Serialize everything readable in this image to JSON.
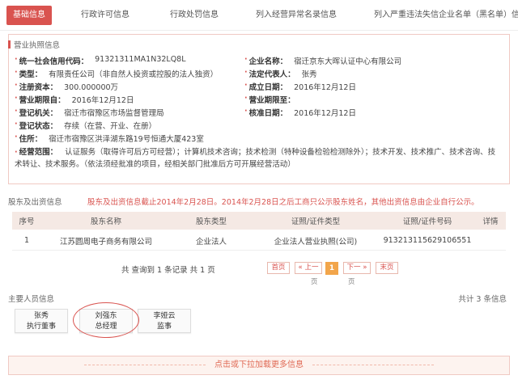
{
  "tabs": [
    {
      "label": "基础信息",
      "active": true
    },
    {
      "label": "行政许可信息",
      "active": false
    },
    {
      "label": "行政处罚信息",
      "active": false
    },
    {
      "label": "列入经营异常名录信息",
      "active": false
    },
    {
      "label": "列入严重违法失信企业名单（黑名单）信息",
      "active": false
    }
  ],
  "license": {
    "section_title": "营业执照信息",
    "credit_code_label": "统一社会信用代码：",
    "credit_code": "91321311MA1N32LQ8L",
    "company_name_label": "企业名称：",
    "company_name": "宿迁京东大晖认证中心有限公司",
    "type_label": "类型：",
    "type": "有限责任公司（非自然人投资或控股的法人独资）",
    "legal_rep_label": "法定代表人：",
    "legal_rep": "张秀",
    "capital_label": "注册资本：",
    "capital": "300.000000万",
    "established_label": "成立日期：",
    "established": "2016年12月12日",
    "term_from_label": "营业期限自：",
    "term_from": "2016年12月12日",
    "term_to_label": "营业期限至：",
    "term_to": "",
    "authority_label": "登记机关：",
    "authority": "宿迁市宿豫区市场监督管理局",
    "approved_label": "核准日期：",
    "approved": "2016年12月12日",
    "status_label": "登记状态：",
    "status": "存续（在营、开业、在册）",
    "address_label": "住所：",
    "address": "宿迁市宿豫区洪泽湖东路19号恒通大厦423室",
    "scope_label": "经营范围：",
    "scope": "认证服务（取得许可后方可经营）；计算机技术咨询；技术检测（特种设备检验检测除外）；技术开发、技术推广、技术咨询、技术转让、技术服务。（依法须经批准的项目，经相关部门批准后方可开展经营活动）"
  },
  "shareholders": {
    "section_title": "股东及出资信息",
    "notice": "股东及出资信息截止2014年2月28日。2014年2月28日之后工商只公示股东姓名，其他出资信息由企业自行公示。",
    "columns": [
      "序号",
      "股东名称",
      "股东类型",
      "证照/证件类型",
      "证照/证件号码",
      "详情"
    ],
    "rows": [
      [
        "1",
        "江苏圆周电子商务有限公司",
        "企业法人",
        "企业法人营业执照(公司)",
        "913213115629106551",
        ""
      ]
    ],
    "pager": {
      "info": "共 查询到 1 条记录 共 1 页",
      "first": "首页",
      "prev": "« 上一",
      "prev_sub": "页",
      "current": "1",
      "next": "下一 »",
      "next_sub": "页",
      "last": "末页"
    }
  },
  "people": {
    "section_title": "主要人员信息",
    "count_text": "共计 3 条信息",
    "items": [
      {
        "name": "张秀",
        "role": "执行董事"
      },
      {
        "name": "刘强东",
        "role": "总经理"
      },
      {
        "name": "李娅云",
        "role": "监事"
      }
    ]
  },
  "load_more": "点击或下拉加载更多信息",
  "colors": {
    "accent": "#d9534f",
    "page_active": "#f2a54a"
  }
}
